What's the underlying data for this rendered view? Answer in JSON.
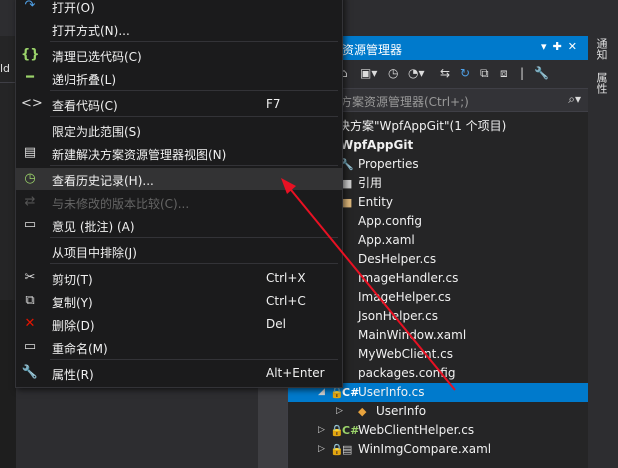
{
  "context_menu": {
    "items": [
      {
        "id": "open",
        "label": "打开(O)",
        "shortcut": "",
        "icon": "redo-arrow-icon",
        "disabled": false
      },
      {
        "id": "open-with",
        "label": "打开方式(N)...",
        "shortcut": "",
        "icon": "",
        "disabled": false
      },
      {
        "id": "clean-selection",
        "label": "清理已选代码(C)",
        "shortcut": "",
        "icon": "braces-icon",
        "disabled": false
      },
      {
        "id": "recursive-collapse",
        "label": "递归折叠(L)",
        "shortcut": "",
        "icon": "collapse-bar-icon",
        "disabled": false
      },
      {
        "id": "view-code",
        "label": "查看代码(C)",
        "shortcut": "F7",
        "icon": "code-icon",
        "disabled": false
      },
      {
        "id": "scope-to-this",
        "label": "限定为此范围(S)",
        "shortcut": "",
        "icon": "",
        "disabled": false
      },
      {
        "id": "new-solution-view",
        "label": "新建解决方案资源管理器视图(N)",
        "shortcut": "",
        "icon": "new-view-icon",
        "disabled": false
      },
      {
        "id": "view-history",
        "label": "查看历史记录(H)...",
        "shortcut": "",
        "icon": "history-icon",
        "disabled": false
      },
      {
        "id": "compare-unmodified",
        "label": "与未修改的版本比较(C)...",
        "shortcut": "",
        "icon": "compare-icon",
        "disabled": true
      },
      {
        "id": "comments",
        "label": "意见 (批注) (A)",
        "shortcut": "",
        "icon": "comment-icon",
        "disabled": false
      },
      {
        "id": "exclude",
        "label": "从项目中排除(J)",
        "shortcut": "",
        "icon": "",
        "disabled": false
      },
      {
        "id": "cut",
        "label": "剪切(T)",
        "shortcut": "Ctrl+X",
        "icon": "scissors-icon",
        "disabled": false
      },
      {
        "id": "copy",
        "label": "复制(Y)",
        "shortcut": "Ctrl+C",
        "icon": "copy-icon",
        "disabled": false
      },
      {
        "id": "delete",
        "label": "删除(D)",
        "shortcut": "Del",
        "icon": "delete-x-icon",
        "disabled": false
      },
      {
        "id": "rename",
        "label": "重命名(M)",
        "shortcut": "",
        "icon": "rename-icon",
        "disabled": false
      },
      {
        "id": "properties",
        "label": "属性(R)",
        "shortcut": "Alt+Enter",
        "icon": "wrench-icon",
        "disabled": false
      }
    ]
  },
  "solution_explorer": {
    "title": "资源管理器",
    "search_placeholder": "方案资源管理器(Ctrl+;)",
    "tree": [
      {
        "label": "决方案\"WpfAppGit\"(1 个项目)",
        "bold": false,
        "icon": ""
      },
      {
        "label": "WpfAppGit",
        "bold": true,
        "icon": "csharp-project-icon"
      },
      {
        "label": "Properties",
        "bold": false,
        "icon": "wrench-icon"
      },
      {
        "label": "引用",
        "bold": false,
        "icon": "references-icon"
      },
      {
        "label": "Entity",
        "bold": false,
        "icon": "folder-icon"
      },
      {
        "label": "App.config",
        "bold": false,
        "icon": "config-file-icon"
      },
      {
        "label": "App.xaml",
        "bold": false,
        "icon": "xaml-file-icon"
      },
      {
        "label": "DesHelper.cs",
        "bold": false,
        "icon": "cs-file-icon"
      },
      {
        "label": "ImageHandler.cs",
        "bold": false,
        "icon": "cs-file-icon"
      },
      {
        "label": "ImageHelper.cs",
        "bold": false,
        "icon": "cs-file-icon"
      },
      {
        "label": "JsonHelper.cs",
        "bold": false,
        "icon": "cs-file-icon"
      },
      {
        "label": "MainWindow.xaml",
        "bold": false,
        "icon": "xaml-file-icon"
      },
      {
        "label": "MyWebClient.cs",
        "bold": false,
        "icon": "cs-file-icon"
      },
      {
        "label": "packages.config",
        "bold": false,
        "icon": "config-file-icon"
      },
      {
        "label": "UserInfo.cs",
        "bold": false,
        "icon": "cs-file-icon",
        "selected": true
      },
      {
        "label": "UserInfo",
        "bold": false,
        "icon": "class-icon"
      },
      {
        "label": "WebClientHelper.cs",
        "bold": false,
        "icon": "cs-file-icon"
      },
      {
        "label": "WinImgCompare.xaml",
        "bold": false,
        "icon": "xaml-file-icon"
      }
    ]
  },
  "right_strip": {
    "tabs": [
      "通知",
      "属性"
    ]
  },
  "left_panel": {
    "text": "ld"
  },
  "colors": {
    "accent": "#007acc",
    "arrow": "#e81123",
    "menu_bg": "#1b1b1c",
    "highlight": "#333334"
  }
}
